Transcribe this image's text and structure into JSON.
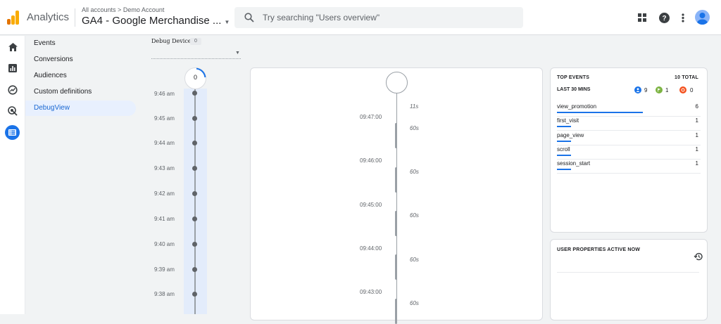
{
  "header": {
    "app_name": "Analytics",
    "breadcrumb_account": "All accounts",
    "breadcrumb_sep": ">",
    "breadcrumb_property": "Demo Account",
    "property_name": "GA4 - Google Merchandise ...",
    "search_placeholder": "Try searching \"Users overview\"",
    "icons": [
      "apps-grid-icon",
      "help-icon",
      "more-vert-icon",
      "account-avatar-icon"
    ]
  },
  "leftnav": {
    "icons": [
      "home-icon",
      "reports-icon",
      "explore-icon",
      "advertising-icon",
      "configure-icon"
    ]
  },
  "menu": {
    "items": [
      {
        "label": "Events"
      },
      {
        "label": "Conversions"
      },
      {
        "label": "Audiences"
      },
      {
        "label": "Custom definitions"
      },
      {
        "label": "DebugView",
        "active": true
      }
    ]
  },
  "debug_device": {
    "label": "Debug Device",
    "count": "0"
  },
  "minutes_stream": {
    "top_count": "0",
    "times": [
      "9:46 am",
      "9:45 am",
      "9:44 am",
      "9:43 am",
      "9:42 am",
      "9:41 am",
      "9:40 am",
      "9:39 am",
      "9:38 am"
    ]
  },
  "seconds_stream": {
    "times": [
      "09:47:00",
      "09:46:00",
      "09:45:00",
      "09:44:00",
      "09:43:00"
    ],
    "durations": [
      "11s",
      "60s",
      "60s",
      "60s",
      "60s",
      "60s"
    ]
  },
  "top_events": {
    "title": "TOP EVENTS",
    "total": "10 TOTAL",
    "period": "LAST 30 MINS",
    "badges": [
      {
        "icon": "person-event-icon",
        "count": "9",
        "color": "#1a73e8"
      },
      {
        "icon": "flag-conversion-icon",
        "count": "1",
        "color": "#7cb342"
      },
      {
        "icon": "error-event-icon",
        "count": "0",
        "color": "#f4511e"
      }
    ],
    "rows": [
      {
        "name": "view_promotion",
        "count": "6",
        "share": 0.6
      },
      {
        "name": "first_visit",
        "count": "1",
        "share": 0.1
      },
      {
        "name": "page_view",
        "count": "1",
        "share": 0.1
      },
      {
        "name": "scroll",
        "count": "1",
        "share": 0.1
      },
      {
        "name": "session_start",
        "count": "1",
        "share": 0.1
      }
    ]
  },
  "user_properties": {
    "title": "USER PROPERTIES ACTIVE NOW",
    "icon": "history-icon"
  },
  "colors": {
    "accent": "#1a73e8",
    "active_bg": "#e8f0fe",
    "stream_bg": "#e3ecfb"
  }
}
